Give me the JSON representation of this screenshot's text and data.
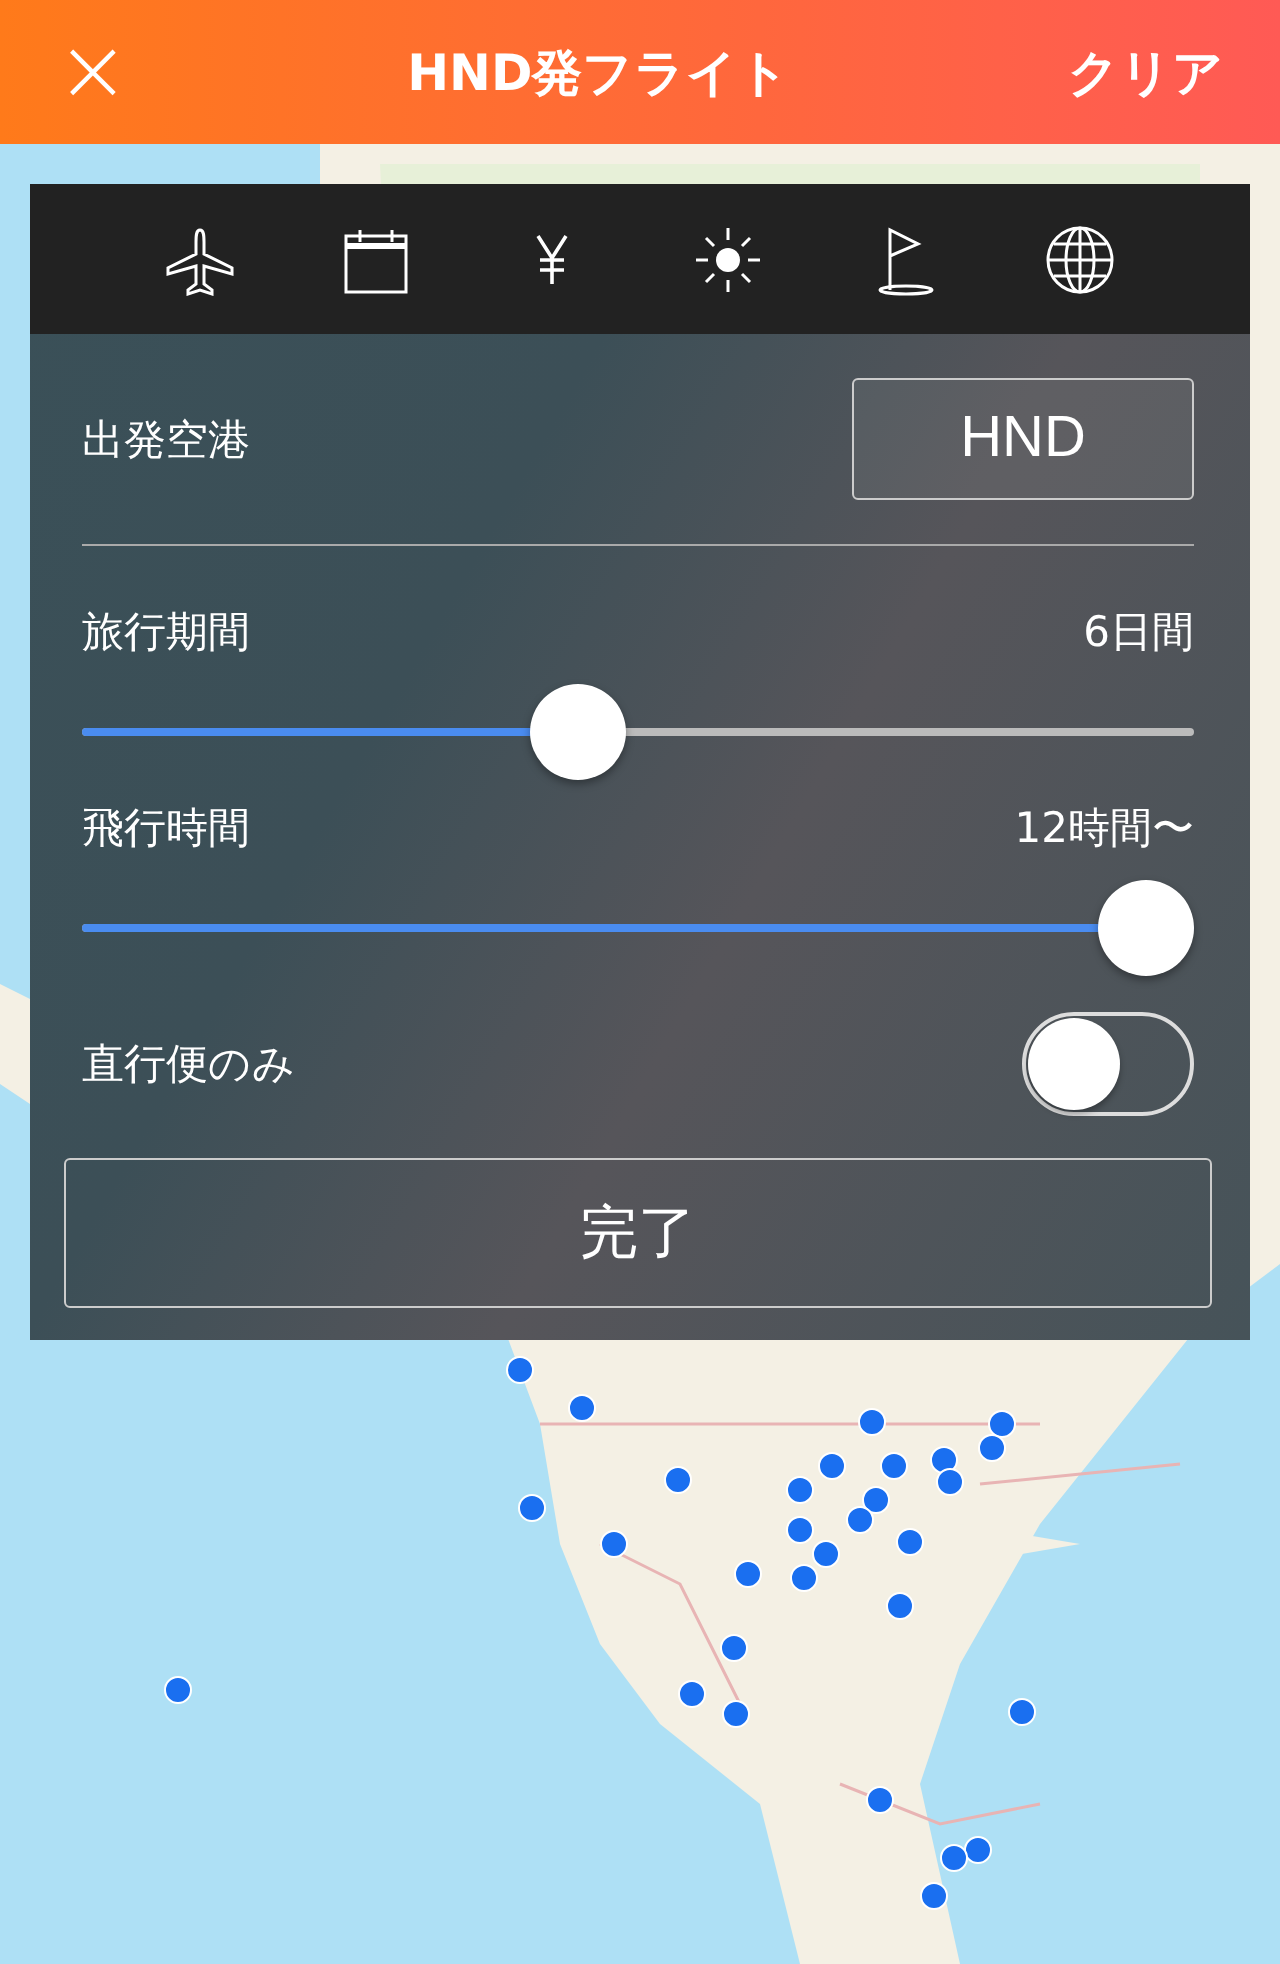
{
  "header": {
    "close_icon": "×",
    "title": "HND発フライト",
    "action": "クリア"
  },
  "filter_tabs": [
    {
      "kind": "plane"
    },
    {
      "kind": "calendar"
    },
    {
      "kind": "yen"
    },
    {
      "kind": "sun"
    },
    {
      "kind": "flag"
    },
    {
      "kind": "globe"
    }
  ],
  "departure": {
    "label": "出発空港",
    "value": "HND"
  },
  "sliders": [
    {
      "label": "旅行期間",
      "reading": "6日間",
      "level": 0.44
    },
    {
      "label": "飛行時間",
      "reading": "12時間〜",
      "level": 1
    }
  ],
  "direct_only": {
    "label": "直行便のみ",
    "on": false
  },
  "done_button": "完了"
}
